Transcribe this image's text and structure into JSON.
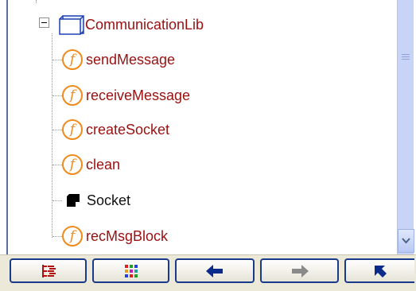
{
  "tree": {
    "root": {
      "label": "CommunicationLib",
      "icon": "library-box-icon",
      "expanded": true
    },
    "children": [
      {
        "label": "sendMessage",
        "icon": "function-icon",
        "icon_glyph": "f",
        "kind": "function"
      },
      {
        "label": "receiveMessage",
        "icon": "function-icon",
        "icon_glyph": "f",
        "kind": "function"
      },
      {
        "label": "createSocket",
        "icon": "function-icon",
        "icon_glyph": "f",
        "kind": "function"
      },
      {
        "label": "clean",
        "icon": "function-icon",
        "icon_glyph": "f",
        "kind": "function"
      },
      {
        "label": "Socket",
        "icon": "type-block-icon",
        "kind": "type"
      },
      {
        "label": "recMsgBlock",
        "icon": "function-icon",
        "icon_glyph": "f",
        "kind": "function"
      }
    ]
  },
  "toolbar": {
    "buttons": [
      {
        "name": "tree-view-button",
        "icon": "tree-view-icon"
      },
      {
        "name": "grid-view-button",
        "icon": "color-grid-icon"
      },
      {
        "name": "back-button",
        "icon": "arrow-left-icon"
      },
      {
        "name": "forward-button",
        "icon": "arrow-right-icon",
        "disabled": true
      },
      {
        "name": "home-button",
        "icon": "arrow-up-left-icon"
      }
    ]
  },
  "colors": {
    "function_label": "#9a1010",
    "function_icon": "#f08a1c",
    "button_border": "#1a3a8c",
    "toolbar_bg": "#ece9d8",
    "scrollbar": "#c7d3f7"
  }
}
